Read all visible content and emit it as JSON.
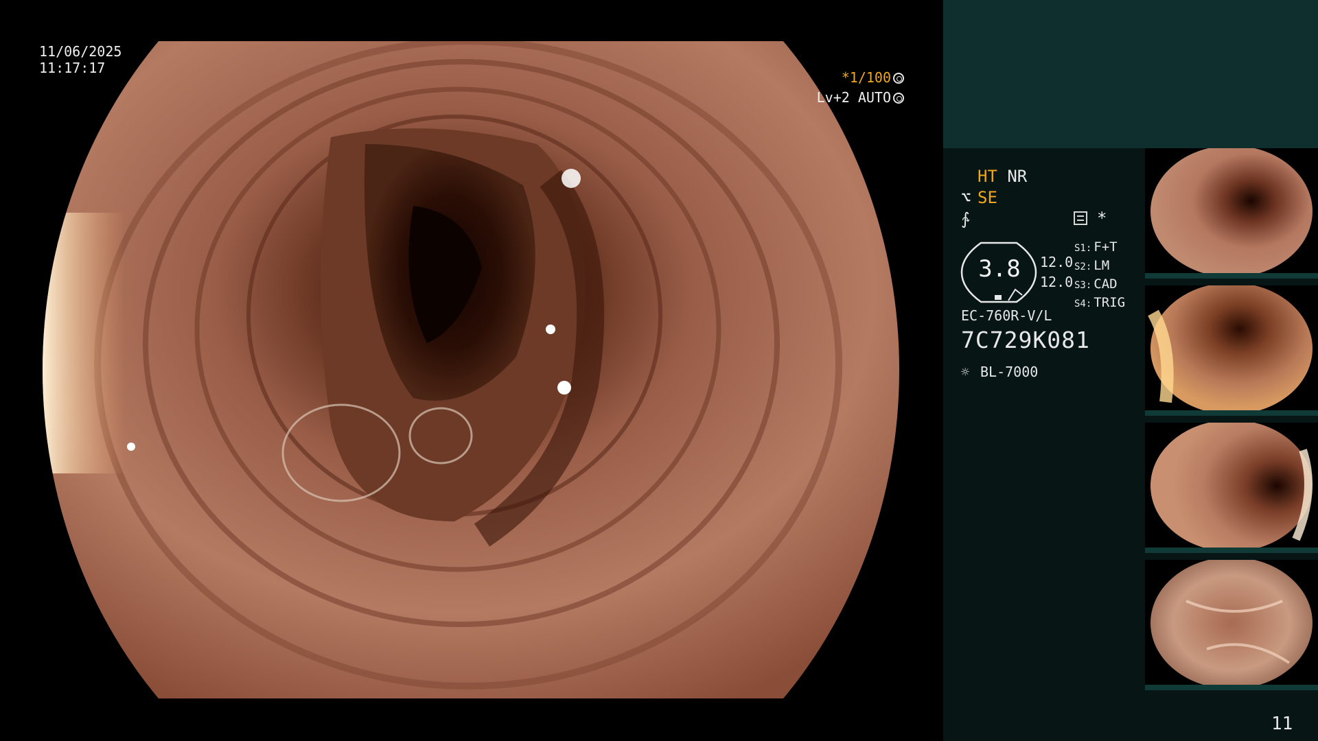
{
  "overlay": {
    "date": "11/06/2025",
    "time": "11:17:17",
    "shutter": "*1/100",
    "level": "Lv+2",
    "iris": "AUTO"
  },
  "panel": {
    "modes": {
      "ht": "HT",
      "nr": "NR",
      "se": "SE"
    },
    "zoom": {
      "value": "3.8",
      "line1": "12.0",
      "line2": "12.0"
    },
    "switches": [
      {
        "label": "S1:",
        "value": "F+T"
      },
      {
        "label": "S2:",
        "value": "LM"
      },
      {
        "label": "S3:",
        "value": "CAD"
      },
      {
        "label": "S4:",
        "value": "TRIG"
      }
    ],
    "star": "*",
    "scope_model": "EC-760R-V/L",
    "scope_serial": "7C729K081",
    "light_source": "BL-7000",
    "page_number": "11"
  },
  "colors": {
    "accent": "#f0a81c",
    "panel_top": "#0f2e2e",
    "panel": "#071514",
    "thumb_bar": "#0f3a36"
  },
  "icons": [
    "ring-icon",
    "shutter-icon",
    "settings-icon",
    "lamp-icon",
    "structure-icon",
    "enhance-icon"
  ]
}
